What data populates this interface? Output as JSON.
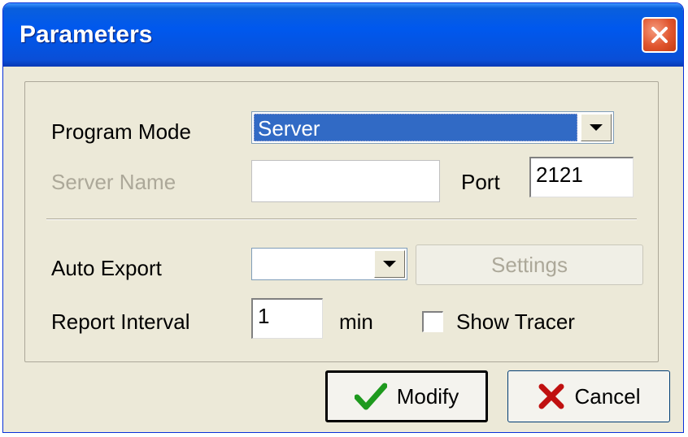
{
  "window": {
    "title": "Parameters",
    "close_icon": "close-icon"
  },
  "program_mode": {
    "label": "Program Mode",
    "value": "Server"
  },
  "server_name": {
    "label": "Server Name",
    "value": ""
  },
  "port": {
    "label": "Port",
    "value": "2121"
  },
  "auto_export": {
    "label": "Auto Export",
    "value": ""
  },
  "settings_button": {
    "label": "Settings"
  },
  "report_interval": {
    "label": "Report Interval",
    "value": "1",
    "unit": "min"
  },
  "show_tracer": {
    "label": "Show Tracer",
    "checked": false
  },
  "buttons": {
    "modify": "Modify",
    "cancel": "Cancel"
  },
  "colors": {
    "titlebar": "#0058ee",
    "close": "#e0552e",
    "selection": "#316ac5",
    "check_icon": "#1e9a1e",
    "cancel_icon": "#c01010"
  }
}
